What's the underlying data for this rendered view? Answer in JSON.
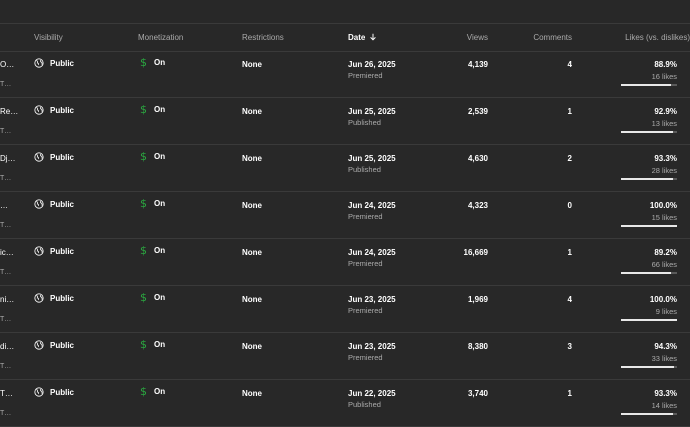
{
  "header": {
    "visibility": "Visibility",
    "monetization": "Monetization",
    "restrictions": "Restrictions",
    "date": "Date",
    "views": "Views",
    "comments": "Comments",
    "likes": "Likes (vs. dislikes)"
  },
  "icons": {
    "visibility": "globe-icon",
    "monetization": "dollar-icon",
    "sort": "arrow-down-icon"
  },
  "colors": {
    "background": "#282828",
    "monetization_green": "#2ba640",
    "muted_text": "#aaaaaa"
  },
  "rows": [
    {
      "title": "O…",
      "sub": "T…",
      "visibility": "Public",
      "monetization": "On",
      "restrictions": "None",
      "date": "Jun 26, 2025",
      "status": "Premiered",
      "views": "4,139",
      "comments": "4",
      "likes_pct": "88.9%",
      "likes_count": "16 likes",
      "likes_ratio": 0.889
    },
    {
      "title": "Re…",
      "sub": "T…",
      "visibility": "Public",
      "monetization": "On",
      "restrictions": "None",
      "date": "Jun 25, 2025",
      "status": "Published",
      "views": "2,539",
      "comments": "1",
      "likes_pct": "92.9%",
      "likes_count": "13 likes",
      "likes_ratio": 0.929
    },
    {
      "title": "Dj…",
      "sub": "T…",
      "visibility": "Public",
      "monetization": "On",
      "restrictions": "None",
      "date": "Jun 25, 2025",
      "status": "Published",
      "views": "4,630",
      "comments": "2",
      "likes_pct": "93.3%",
      "likes_count": "28 likes",
      "likes_ratio": 0.933
    },
    {
      "title": "…",
      "sub": "T…",
      "visibility": "Public",
      "monetization": "On",
      "restrictions": "None",
      "date": "Jun 24, 2025",
      "status": "Premiered",
      "views": "4,323",
      "comments": "0",
      "likes_pct": "100.0%",
      "likes_count": "15 likes",
      "likes_ratio": 1.0
    },
    {
      "title": "ic…",
      "sub": "T…",
      "visibility": "Public",
      "monetization": "On",
      "restrictions": "None",
      "date": "Jun 24, 2025",
      "status": "Premiered",
      "views": "16,669",
      "comments": "1",
      "likes_pct": "89.2%",
      "likes_count": "66 likes",
      "likes_ratio": 0.892
    },
    {
      "title": "ni…",
      "sub": "T…",
      "visibility": "Public",
      "monetization": "On",
      "restrictions": "None",
      "date": "Jun 23, 2025",
      "status": "Premiered",
      "views": "1,969",
      "comments": "4",
      "likes_pct": "100.0%",
      "likes_count": "9 likes",
      "likes_ratio": 1.0
    },
    {
      "title": "di…",
      "sub": "T…",
      "visibility": "Public",
      "monetization": "On",
      "restrictions": "None",
      "date": "Jun 23, 2025",
      "status": "Premiered",
      "views": "8,380",
      "comments": "3",
      "likes_pct": "94.3%",
      "likes_count": "33 likes",
      "likes_ratio": 0.943
    },
    {
      "title": "T…",
      "sub": "T…",
      "visibility": "Public",
      "monetization": "On",
      "restrictions": "None",
      "date": "Jun 22, 2025",
      "status": "Published",
      "views": "3,740",
      "comments": "1",
      "likes_pct": "93.3%",
      "likes_count": "14 likes",
      "likes_ratio": 0.933
    }
  ]
}
